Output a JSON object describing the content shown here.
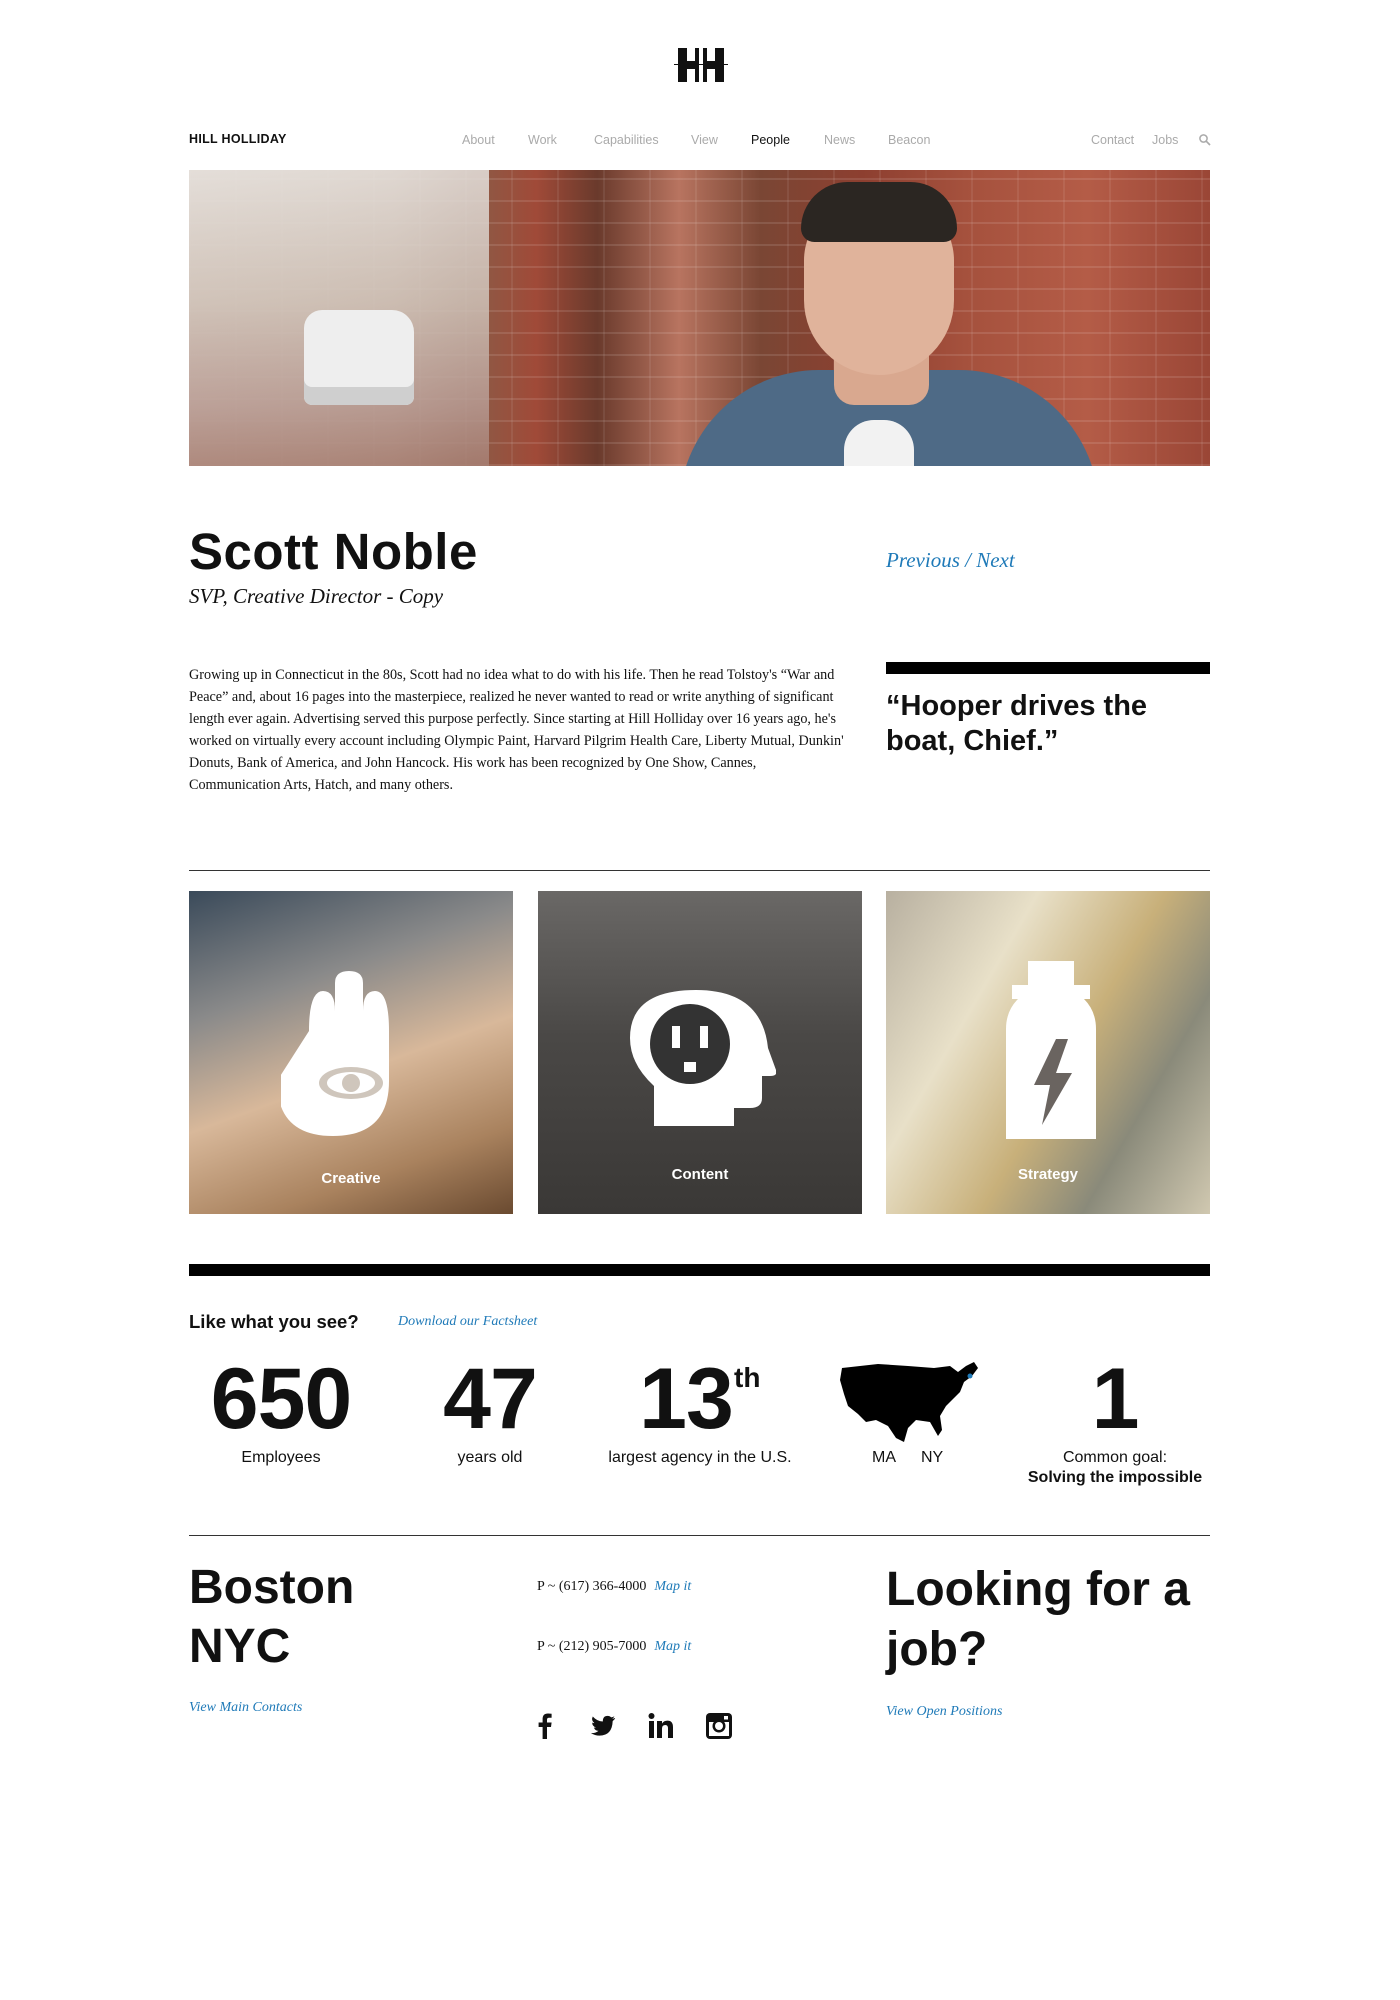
{
  "header": {
    "brand": "HILL HOLLIDAY",
    "logo_icon": "hh-monogram-icon",
    "nav": [
      "About",
      "Work",
      "Capabilities",
      "View",
      "People",
      "News",
      "Beacon"
    ],
    "active_nav": "People",
    "utility": [
      "Contact",
      "Jobs"
    ],
    "search_icon": "search-icon"
  },
  "profile": {
    "name": "Scott Noble",
    "title": "SVP, Creative Director - Copy",
    "prev_next": "Previous / Next",
    "bio": "Growing up in Connecticut in the 80s, Scott had no idea what to do with his life. Then he read Tolstoy's “War and Peace” and, about 16 pages into the masterpiece, realized he never wanted to read or write anything of significant length ever again. Advertising served this purpose perfectly. Since starting at Hill Holliday over 16 years ago, he's worked on virtually every account including Olympic Paint, Harvard Pilgrim Health Care, Liberty Mutual, Dunkin' Donuts, Bank of America, and John Hancock. His work has been recognized by One Show, Cannes, Communication Arts, Hatch, and many others.",
    "quote": "“Hooper drives the boat, Chief.”"
  },
  "capabilities": [
    {
      "label": "Creative",
      "icon": "hand-eye-icon"
    },
    {
      "label": "Content",
      "icon": "head-outlet-icon"
    },
    {
      "label": "Strategy",
      "icon": "bottle-bolt-icon"
    }
  ],
  "facts": {
    "heading": "Like what you see?",
    "download_link": "Download our Factsheet",
    "employees": {
      "value": "650",
      "label": "Employees"
    },
    "years": {
      "value": "47",
      "label": "years old"
    },
    "rank": {
      "value": "13",
      "suffix": "th",
      "label": "largest agency in the U.S."
    },
    "map": {
      "icon": "usa-map-icon",
      "labels": [
        "MA",
        "NY"
      ]
    },
    "goal": {
      "value": "1",
      "label": "Common goal:",
      "detail": "Solving the impossible"
    }
  },
  "footer": {
    "cities": [
      "Boston",
      "NYC"
    ],
    "main_contacts": "View Main Contacts",
    "phones": [
      {
        "number": "P ~ (617) 366-4000",
        "map": "Map it"
      },
      {
        "number": "P ~ (212) 905-7000",
        "map": "Map it"
      }
    ],
    "social": [
      "facebook-icon",
      "twitter-icon",
      "linkedin-icon",
      "instagram-icon"
    ],
    "job_heading": "Looking for a job?",
    "positions_link": "View Open Positions"
  },
  "colors": {
    "link_blue": "#1f7ab8",
    "nav_inactive": "#aaaaaa",
    "text": "#111111"
  }
}
